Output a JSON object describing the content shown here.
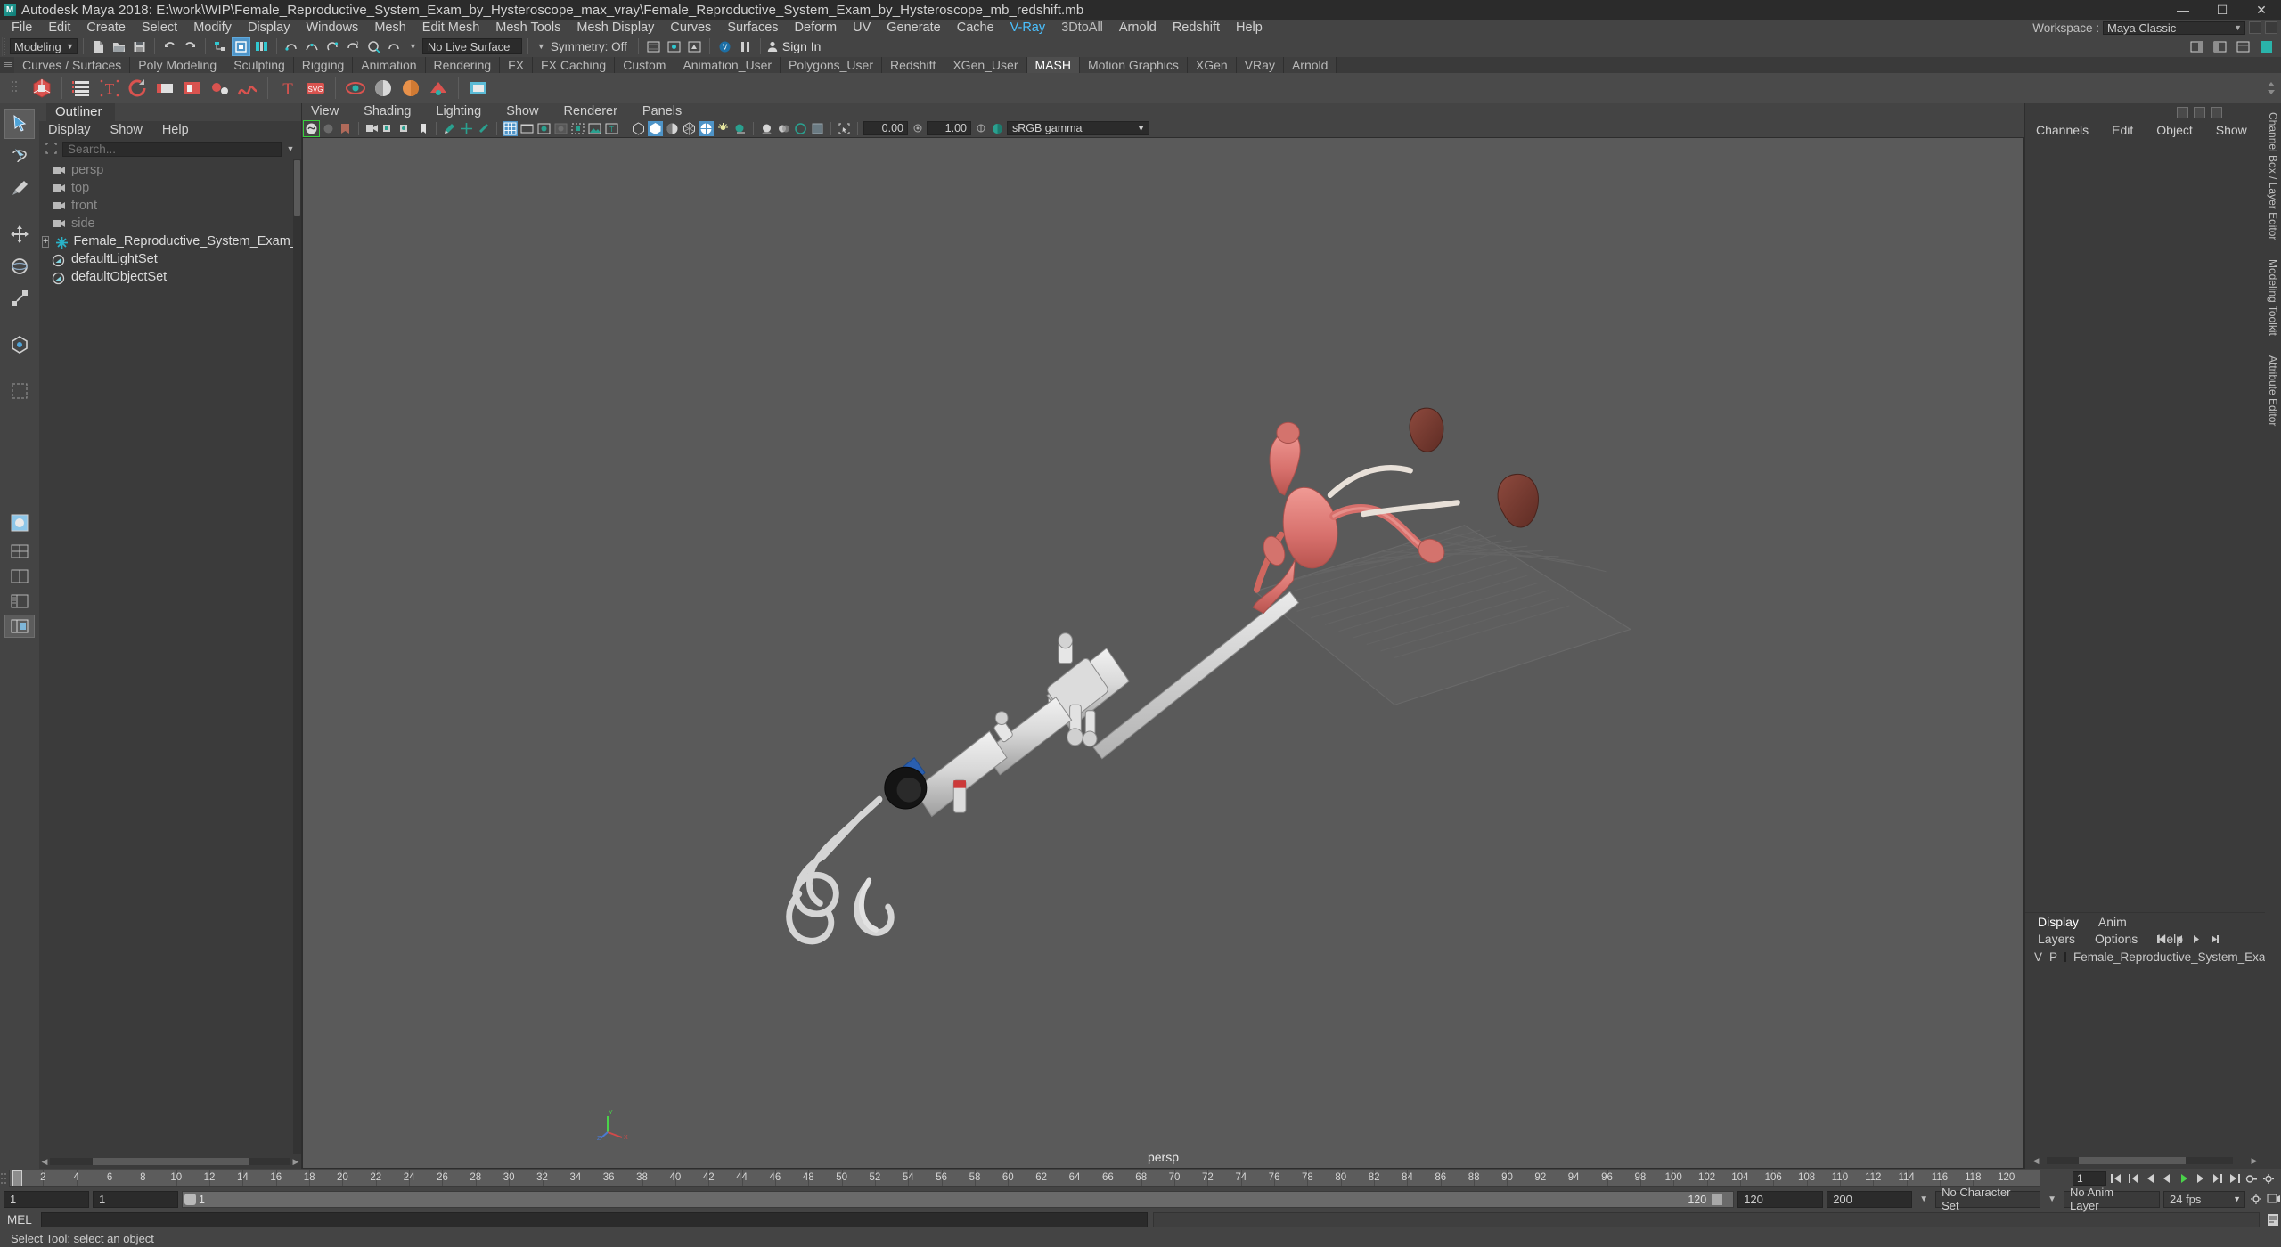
{
  "window": {
    "title": "Autodesk Maya 2018: E:\\work\\WIP\\Female_Reproductive_System_Exam_by_Hysteroscope_max_vray\\Female_Reproductive_System_Exam_by_Hysteroscope_mb_redshift.mb",
    "logo_text": "M",
    "minimize": "—",
    "maximize": "☐",
    "close": "✕"
  },
  "menubar": {
    "items": [
      "File",
      "Edit",
      "Create",
      "Select",
      "Modify",
      "Display",
      "Windows",
      "Mesh",
      "Edit Mesh",
      "Mesh Tools",
      "Mesh Display",
      "Curves",
      "Surfaces",
      "Deform",
      "UV",
      "Generate",
      "Cache",
      "V-Ray",
      "3DtoAll",
      "Arnold",
      "Redshift",
      "Help"
    ],
    "highlight": "V-Ray",
    "workspace_label": "Workspace :",
    "workspace_value": "Maya Classic"
  },
  "statusline": {
    "mode": "Modeling",
    "live_surface": "No Live Surface",
    "symmetry": "Symmetry: Off",
    "sign_in": "Sign In",
    "snap_value_1": "",
    "icons": [
      "new-scene-icon",
      "open-scene-icon",
      "save-scene-icon",
      "undo-icon",
      "redo-icon",
      "select-hierarchy-icon",
      "select-object-icon",
      "select-component-icon",
      "snap-grid-icon",
      "snap-curve-icon",
      "snap-point-icon",
      "snap-projected-icon",
      "snap-view-plane-icon",
      "make-live-icon"
    ]
  },
  "shelf": {
    "tabs": [
      "Curves / Surfaces",
      "Poly Modeling",
      "Sculpting",
      "Rigging",
      "Animation",
      "Rendering",
      "FX",
      "FX Caching",
      "Custom",
      "Animation_User",
      "Polygons_User",
      "Redshift",
      "XGen_User",
      "MASH",
      "Motion Graphics",
      "XGen",
      "VRay",
      "Arnold"
    ],
    "active_tab": "MASH",
    "icons": [
      "mash-network-icon",
      "mash-menu-icon",
      "mash-text-icon",
      "mash-trails-icon",
      "mash-curve-icon",
      "mash-repro-icon",
      "mash-dynamics-icon",
      "mash-signal-icon",
      "mash-waiter-icon",
      "mash-type-icon",
      "mash-svg-icon",
      "mash-placer-icon",
      "mash-sphere-icon",
      "mash-color-icon",
      "mash-flight-icon",
      "mash-fan-icon",
      "mash-blend-icon"
    ]
  },
  "toolbox": {
    "tools": [
      "select-tool",
      "lasso-select-tool",
      "paint-select-tool",
      "move-tool",
      "rotate-tool",
      "scale-tool",
      "last-tool",
      "persp-view-layout-icon",
      "four-view-layout-icon",
      "two-pane-layout-icon",
      "outliner-persp-layout-icon",
      "hypergraph-persp-layout-icon"
    ]
  },
  "outliner": {
    "tab_label": "Outliner",
    "menus": [
      "Display",
      "Show",
      "Help"
    ],
    "search_placeholder": "Search...",
    "items": [
      {
        "label": "persp",
        "icon": "camera-icon",
        "dim": true,
        "expandable": false
      },
      {
        "label": "top",
        "icon": "camera-icon",
        "dim": true,
        "expandable": false
      },
      {
        "label": "front",
        "icon": "camera-icon",
        "dim": true,
        "expandable": false
      },
      {
        "label": "side",
        "icon": "camera-icon",
        "dim": true,
        "expandable": false
      },
      {
        "label": "Female_Reproductive_System_Exam_b",
        "icon": "transform-group-icon",
        "dim": false,
        "expandable": true
      },
      {
        "label": "defaultLightSet",
        "icon": "set-icon",
        "dim": false,
        "expandable": false
      },
      {
        "label": "defaultObjectSet",
        "icon": "set-icon",
        "dim": false,
        "expandable": false
      }
    ]
  },
  "viewport": {
    "menus": [
      "View",
      "Shading",
      "Lighting",
      "Show",
      "Renderer",
      "Panels"
    ],
    "exposure_value": "0.00",
    "gamma_value": "1.00",
    "color_space": "sRGB gamma",
    "camera_label": "persp",
    "axis_labels": {
      "y": "Y",
      "x": "X",
      "z": "Z"
    }
  },
  "channelbox": {
    "menus": [
      "Channels",
      "Edit",
      "Object",
      "Show"
    ]
  },
  "layers": {
    "tabs": [
      "Display",
      "Anim"
    ],
    "active_tab": "Display",
    "menus": [
      "Layers",
      "Options",
      "Help"
    ],
    "col_v": "V",
    "col_p": "P",
    "rows": [
      {
        "name": "Female_Reproductive_System_Exa",
        "color": "#e2506a",
        "visible": "",
        "playback": ""
      }
    ]
  },
  "sidebar_vertical_tabs": [
    "Channel Box / Layer Editor",
    "Modeling Toolkit",
    "Attribute Editor"
  ],
  "timeline": {
    "start_frame": "1",
    "end_frame": "120",
    "current_frame": "1",
    "ticks": [
      "2",
      "4",
      "6",
      "8",
      "10",
      "12",
      "14",
      "16",
      "18",
      "20",
      "22",
      "24",
      "26",
      "28",
      "30",
      "32",
      "34",
      "36",
      "38",
      "40",
      "42",
      "44",
      "46",
      "48",
      "50",
      "52",
      "54",
      "56",
      "58",
      "60",
      "62",
      "64",
      "66",
      "68",
      "70",
      "72",
      "74",
      "76",
      "78",
      "80",
      "82",
      "84",
      "86",
      "88",
      "90",
      "92",
      "94",
      "96",
      "98",
      "100",
      "102",
      "104",
      "106",
      "108",
      "110",
      "112",
      "114",
      "116",
      "118",
      "120"
    ],
    "fps_field": "24 fps",
    "key_field": "1"
  },
  "range": {
    "range_start": "1",
    "range_end": "1",
    "playback_start": "1",
    "playback_end": "120",
    "anim_start": "120",
    "anim_end": "200",
    "character_set": "No Character Set",
    "anim_layer": "No Anim Layer",
    "fps": "24 fps"
  },
  "command": {
    "language": "MEL",
    "input_value": "",
    "output_value": ""
  },
  "helpline": {
    "text": "Select Tool: select an object"
  },
  "colors": {
    "accent_blue": "#4e94c8",
    "vray_blue": "#4ac1ff",
    "layer_swatch": "#e2506a",
    "viewport_bg": "#5a5a5a",
    "panel_bg": "#3b3b3b",
    "chrome_bg": "#444444",
    "titlebar_bg": "#2b2b2b"
  }
}
